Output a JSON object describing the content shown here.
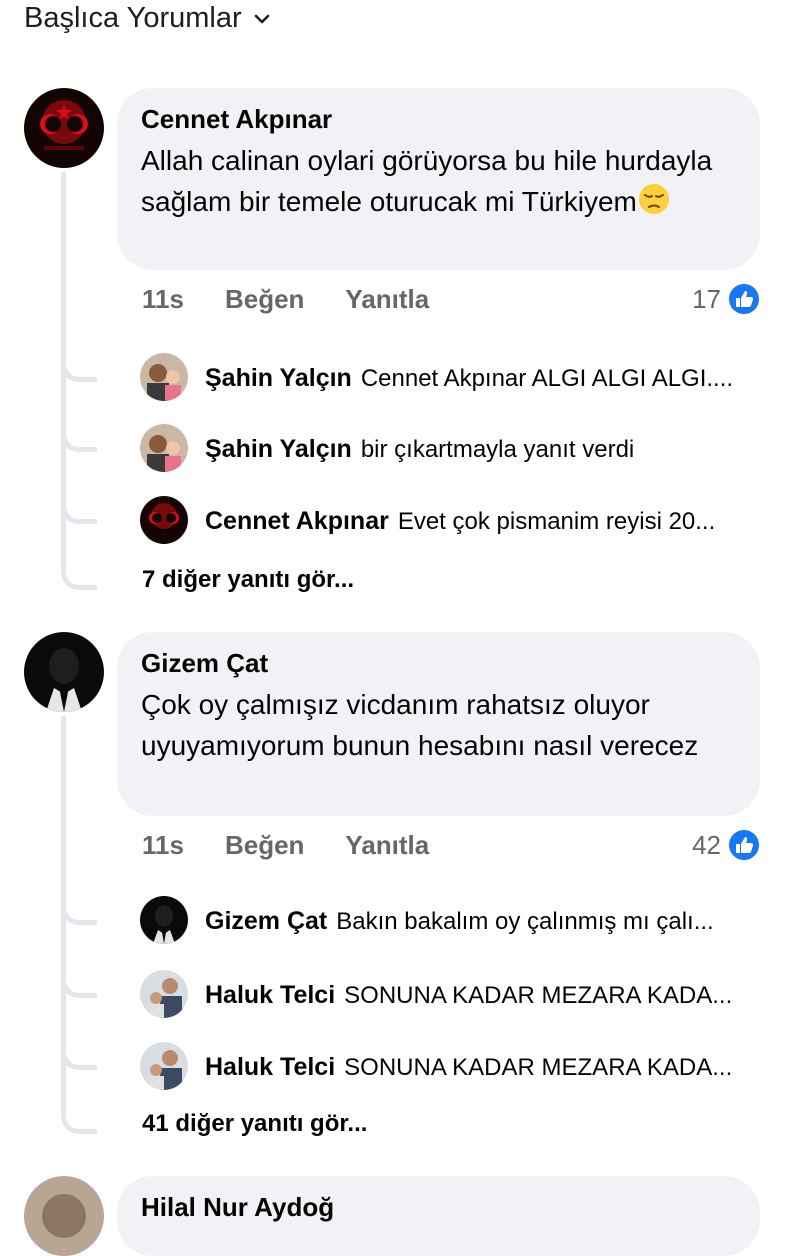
{
  "header": {
    "title": "Başlıca Yorumlar",
    "chevron_icon": "chevron-down-icon"
  },
  "comments": [
    {
      "author": "Cennet Akpınar",
      "text": "Allah calinan oylari görüyorsa bu hile hurdayla sağlam bir temele oturucak mi Türkiyem",
      "emoji": "pensive-face-icon",
      "time": "11s",
      "like_label": "Beğen",
      "reply_label": "Yanıtla",
      "reaction_count": "17",
      "replies": [
        {
          "author": "Şahin Yalçın",
          "text": "Cennet Akpınar ALGI ALGI ALGI...."
        },
        {
          "author": "Şahin Yalçın",
          "text": "bir çıkartmayla yanıt verdi"
        },
        {
          "author": "Cennet Akpınar",
          "text": "Evet çok pismanim reyisi 20..."
        }
      ],
      "more_replies": "7 diğer yanıtı gör..."
    },
    {
      "author": "Gizem Çat",
      "text": "Çok oy çalmışız vicdanım rahatsız oluyor uyuyamıyorum bunun hesabını nasıl verecez",
      "time": "11s",
      "like_label": "Beğen",
      "reply_label": "Yanıtla",
      "reaction_count": "42",
      "replies": [
        {
          "author": "Gizem Çat",
          "text": "Bakın bakalım oy çalınmış mı çalı..."
        },
        {
          "author": "Haluk Telci",
          "text": "SONUNA KADAR MEZARA KADA..."
        },
        {
          "author": "Haluk Telci",
          "text": "SONUNA KADAR MEZARA KADA..."
        }
      ],
      "more_replies": "41 diğer yanıtı gör..."
    },
    {
      "author": "Hilal Nur Aydoğ"
    }
  ],
  "colors": {
    "bubble": "#f0f2f5",
    "secondary_text": "#65676b",
    "like_blue": "#1877f2",
    "thread_line": "#e4e6eb"
  }
}
